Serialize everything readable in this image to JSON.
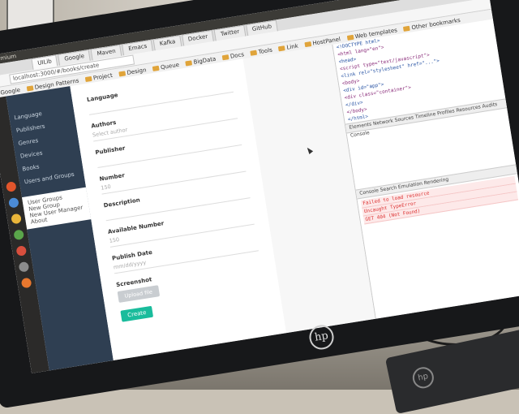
{
  "browser": {
    "os_title": "Chromium",
    "tabs": [
      "UILib",
      "Google",
      "Maven",
      "Emacs",
      "Kafka",
      "Docker",
      "Twitter",
      "GitHub"
    ],
    "active_tab": "UILib",
    "url": "localhost:3000/#/books/create",
    "bookmarks": [
      "Google",
      "Design Patterns",
      "Project",
      "Design",
      "Queue",
      "BigData",
      "Docs",
      "Tools",
      "Link",
      "HostPanel",
      "Web templates",
      "Other bookmarks"
    ]
  },
  "sidebar": {
    "items": [
      {
        "label": "Language",
        "sub": false
      },
      {
        "label": "Publishers",
        "sub": false
      },
      {
        "label": "Genres",
        "sub": false
      },
      {
        "label": "Devices",
        "sub": false
      },
      {
        "label": "Books",
        "sub": false
      },
      {
        "label": "Users and Groups",
        "sub": false
      }
    ],
    "bottom_items": [
      "User Groups",
      "New Group",
      "New User Manager",
      "About"
    ]
  },
  "form": {
    "fields": [
      {
        "label": "Language",
        "value": ""
      },
      {
        "label": "Authors",
        "value": "Select author"
      },
      {
        "label": "Publisher",
        "value": ""
      },
      {
        "label": "Number",
        "value": "150"
      },
      {
        "label": "Description",
        "value": ""
      },
      {
        "label": "Available Number",
        "value": "150"
      },
      {
        "label": "Publish Date",
        "value": "mm/dd/yyyy"
      },
      {
        "label": "Screenshot",
        "value": ""
      }
    ],
    "upload_label": "Upload file",
    "create_label": "Create"
  },
  "devtools": {
    "tabs": "Elements  Network  Sources  Timeline  Profiles  Resources  Audits  Console",
    "console_tabs": "Console  Search  Emulation  Rendering",
    "code_lines": [
      "<!DOCTYPE html>",
      "<html lang=\"en\">",
      "<head>",
      "<script type=\"text/javascript\">",
      "<link rel=\"stylesheet\" href=\"...\">",
      "<body>",
      "<div id=\"app\">",
      "<div class=\"container\">",
      "</div>",
      "</body>",
      "</html>"
    ],
    "errors": [
      "Failed to load resource",
      "Uncaught TypeError",
      "GET 404 (Not Found)"
    ]
  },
  "colors": {
    "sidebar_bg": "#2f3f52",
    "create_button": "#1abc9c",
    "error_text": "#d33333"
  }
}
